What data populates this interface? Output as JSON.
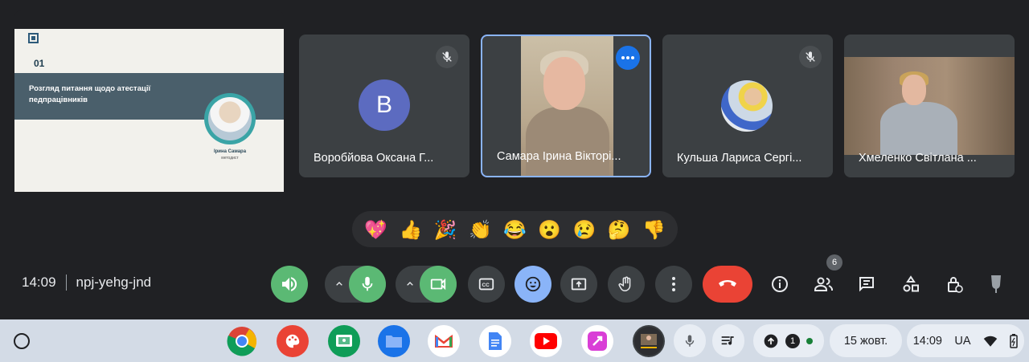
{
  "presentation": {
    "slide_number": "01",
    "slide_title": "Розгляд питання щодо атестації педпрацівників",
    "presenter_name": "Ірина Самара",
    "presenter_role": "методист"
  },
  "participants": [
    {
      "name": "Воробйова Оксана Г...",
      "avatar_letter": "B",
      "muted": true
    },
    {
      "name": "Самара Ірина Вікторі...",
      "active": true
    },
    {
      "name": "Кульша Лариса Сергі...",
      "muted": true
    },
    {
      "name": "Хмеленко Світлана ..."
    }
  ],
  "reactions": [
    "💖",
    "👍",
    "🎉",
    "👏",
    "😂",
    "😮",
    "😢",
    "🤔",
    "👎"
  ],
  "meeting": {
    "time": "14:09",
    "code": "npj-yehg-jnd",
    "participants_count": "6"
  },
  "icons": {
    "speaker": "speaker-icon",
    "mic": "mic-icon",
    "camera": "camera-icon",
    "captions": "captions-icon",
    "emoji": "emoji-icon",
    "present": "present-icon",
    "hand": "raise-hand-icon",
    "more": "more-options-icon",
    "leave": "leave-call-icon",
    "info": "info-icon",
    "people": "people-icon",
    "chat": "chat-icon",
    "activities": "activities-icon",
    "host": "host-controls-icon"
  },
  "shelf": {
    "apps": [
      "Chrome",
      "Canvas",
      "Classroom",
      "Files",
      "Gmail",
      "Docs",
      "YouTube",
      "Sketch",
      "Meet"
    ],
    "notification_count": "1",
    "date": "15 жовт.",
    "time": "14:09",
    "input_method": "UA"
  },
  "colors": {
    "background": "#202124",
    "tile": "#3c4043",
    "green": "#5bb974",
    "blue": "#8ab4f8",
    "red": "#ea4335",
    "shelf": "#d3dbe6"
  }
}
